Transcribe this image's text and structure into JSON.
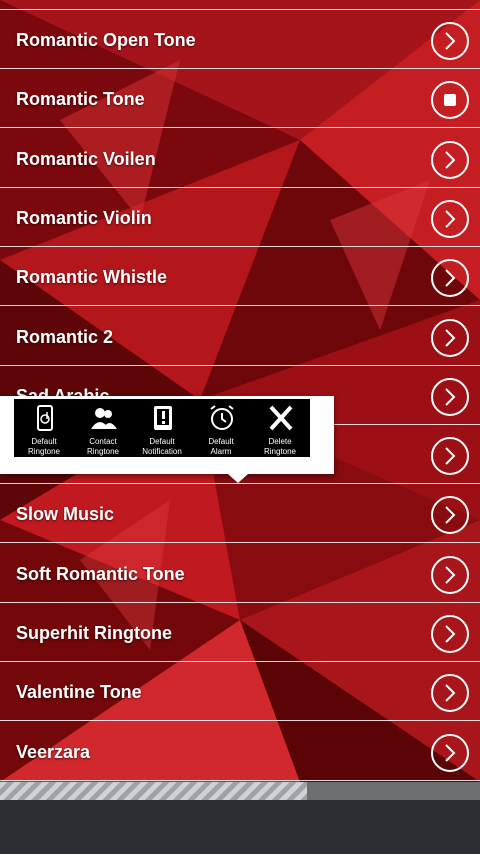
{
  "list": {
    "rows": [
      {
        "label": "Romantic Open Tone",
        "state": "play"
      },
      {
        "label": "Romantic Tone",
        "state": "stop"
      },
      {
        "label": "Romantic Voilen",
        "state": "play"
      },
      {
        "label": "Romantic Violin",
        "state": "play"
      },
      {
        "label": "Romantic Whistle",
        "state": "play"
      },
      {
        "label": "Romantic 2",
        "state": "play"
      },
      {
        "label": "Sad Arabic",
        "state": "play"
      },
      {
        "label": "",
        "state": "play"
      },
      {
        "label": "Slow Music",
        "state": "play"
      },
      {
        "label": "Soft Romantic Tone",
        "state": "play"
      },
      {
        "label": "Superhit Ringtone",
        "state": "play"
      },
      {
        "label": "Valentine Tone",
        "state": "play"
      },
      {
        "label": "Veerzara",
        "state": "play"
      }
    ]
  },
  "popup": {
    "items": [
      {
        "line1": "Default",
        "line2": "Ringtone",
        "icon": "phone-music-icon"
      },
      {
        "line1": "Contact",
        "line2": "Ringtone",
        "icon": "contacts-icon"
      },
      {
        "line1": "Default",
        "line2": "Notification",
        "icon": "notification-icon"
      },
      {
        "line1": "Default",
        "line2": "Alarm",
        "icon": "alarm-clock-icon"
      },
      {
        "line1": "Delete",
        "line2": "Ringtone",
        "icon": "delete-x-icon"
      }
    ]
  },
  "playback": {
    "progress": 0.64
  },
  "colors": {
    "background_red": "#8e0b10",
    "accent_white": "#ffffff",
    "popup_bar": "#000000"
  }
}
